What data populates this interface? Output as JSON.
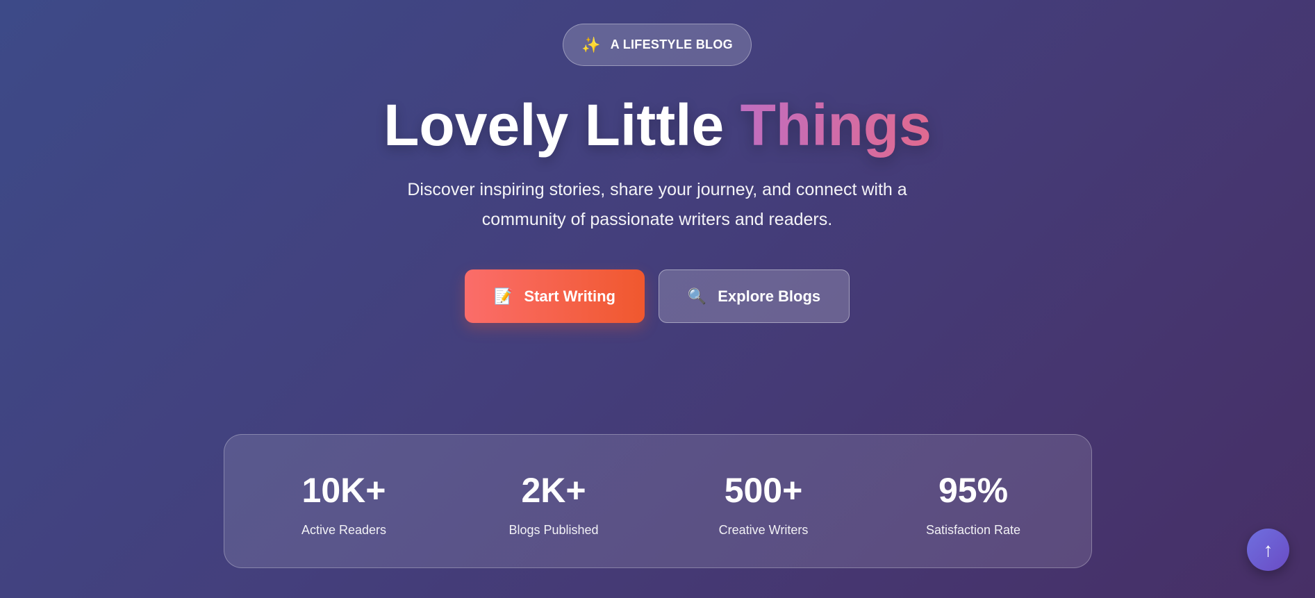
{
  "badge": {
    "icon": "sparkles-icon",
    "icon_glyph": "✨",
    "label": "A LIFESTYLE BLOG"
  },
  "hero": {
    "title_main": "Lovely Little",
    "title_accent": "Things",
    "subtitle": "Discover inspiring stories, share your journey, and connect with a community of passionate writers and readers."
  },
  "actions": {
    "start_writing": {
      "icon": "memo-icon",
      "icon_glyph": "📝",
      "label": "Start Writing"
    },
    "explore_blogs": {
      "icon": "magnifier-icon",
      "icon_glyph": "🔍",
      "label": "Explore Blogs"
    }
  },
  "stats": [
    {
      "value": "10K+",
      "label": "Active Readers"
    },
    {
      "value": "2K+",
      "label": "Blogs Published"
    },
    {
      "value": "500+",
      "label": "Creative Writers"
    },
    {
      "value": "95%",
      "label": "Satisfaction Rate"
    }
  ],
  "scroll_top": {
    "icon": "arrow-up-icon",
    "icon_glyph": "↑"
  },
  "colors": {
    "background_start": "#3d4a88",
    "background_end": "#472f66",
    "accent_pink": "#e06a90",
    "accent_purple": "#c06ec0",
    "primary_button": "#f0582e",
    "scroll_button": "#6a4cc4"
  }
}
